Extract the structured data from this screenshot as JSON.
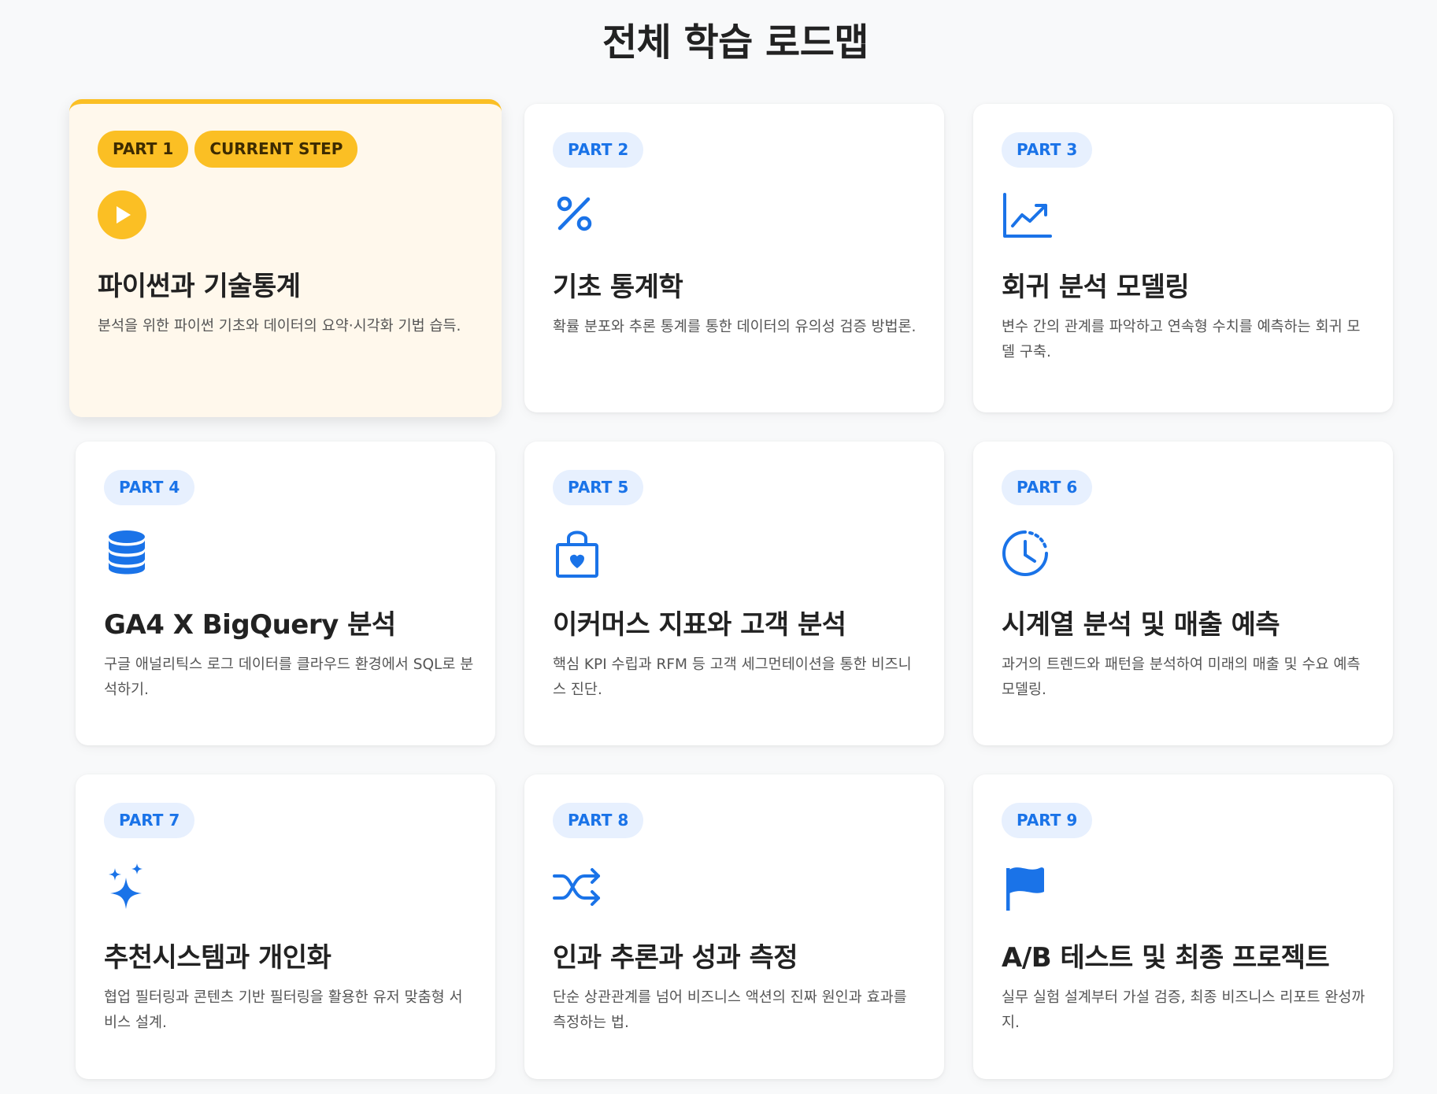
{
  "page": {
    "title": "전체 학습 로드맵"
  },
  "colors": {
    "accent_blue": "#1a73e8",
    "accent_yellow": "#fbbf24",
    "current_bg": "#fff8ec"
  },
  "cards": [
    {
      "part": "PART 1",
      "status": "CURRENT STEP",
      "icon": "play-circle-icon",
      "title": "파이썬과 기술통계",
      "desc": "분석을 위한 파이썬 기초와 데이터의 요약·시각화 기법 습득."
    },
    {
      "part": "PART 2",
      "icon": "percent-icon",
      "title": "기초 통계학",
      "desc": "확률 분포와 추론 통계를 통한 데이터의 유의성 검증 방법론."
    },
    {
      "part": "PART 3",
      "icon": "trending-up-icon",
      "title": "회귀 분석 모델링",
      "desc": "변수 간의 관계를 파악하고 연속형 수치를 예측하는 회귀 모델 구축."
    },
    {
      "part": "PART 4",
      "icon": "database-icon",
      "title": "GA4 X BigQuery 분석",
      "desc": "구글 애널리틱스 로그 데이터를 클라우드 환경에서 SQL로 분석하기."
    },
    {
      "part": "PART 5",
      "icon": "shopping-bag-heart-icon",
      "title": "이커머스 지표와 고객 분석",
      "desc": "핵심 KPI 수립과 RFM 등 고객 세그먼테이션을 통한 비즈니스 진단."
    },
    {
      "part": "PART 6",
      "icon": "clock-history-icon",
      "title": "시계열 분석 및 매출 예측",
      "desc": "과거의 트렌드와 패턴을 분석하여 미래의 매출 및 수요 예측 모델링."
    },
    {
      "part": "PART 7",
      "icon": "sparkles-icon",
      "title": "추천시스템과 개인화",
      "desc": "협업 필터링과 콘텐츠 기반 필터링을 활용한 유저 맞춤형 서비스 설계."
    },
    {
      "part": "PART 8",
      "icon": "shuffle-icon",
      "title": "인과 추론과 성과 측정",
      "desc": "단순 상관관계를 넘어 비즈니스 액션의 진짜 원인과 효과를 측정하는 법."
    },
    {
      "part": "PART 9",
      "icon": "flag-icon",
      "title": "A/B 테스트 및 최종 프로젝트",
      "desc": "실무 실험 설계부터 가설 검증, 최종 비즈니스 리포트 완성까지."
    }
  ]
}
